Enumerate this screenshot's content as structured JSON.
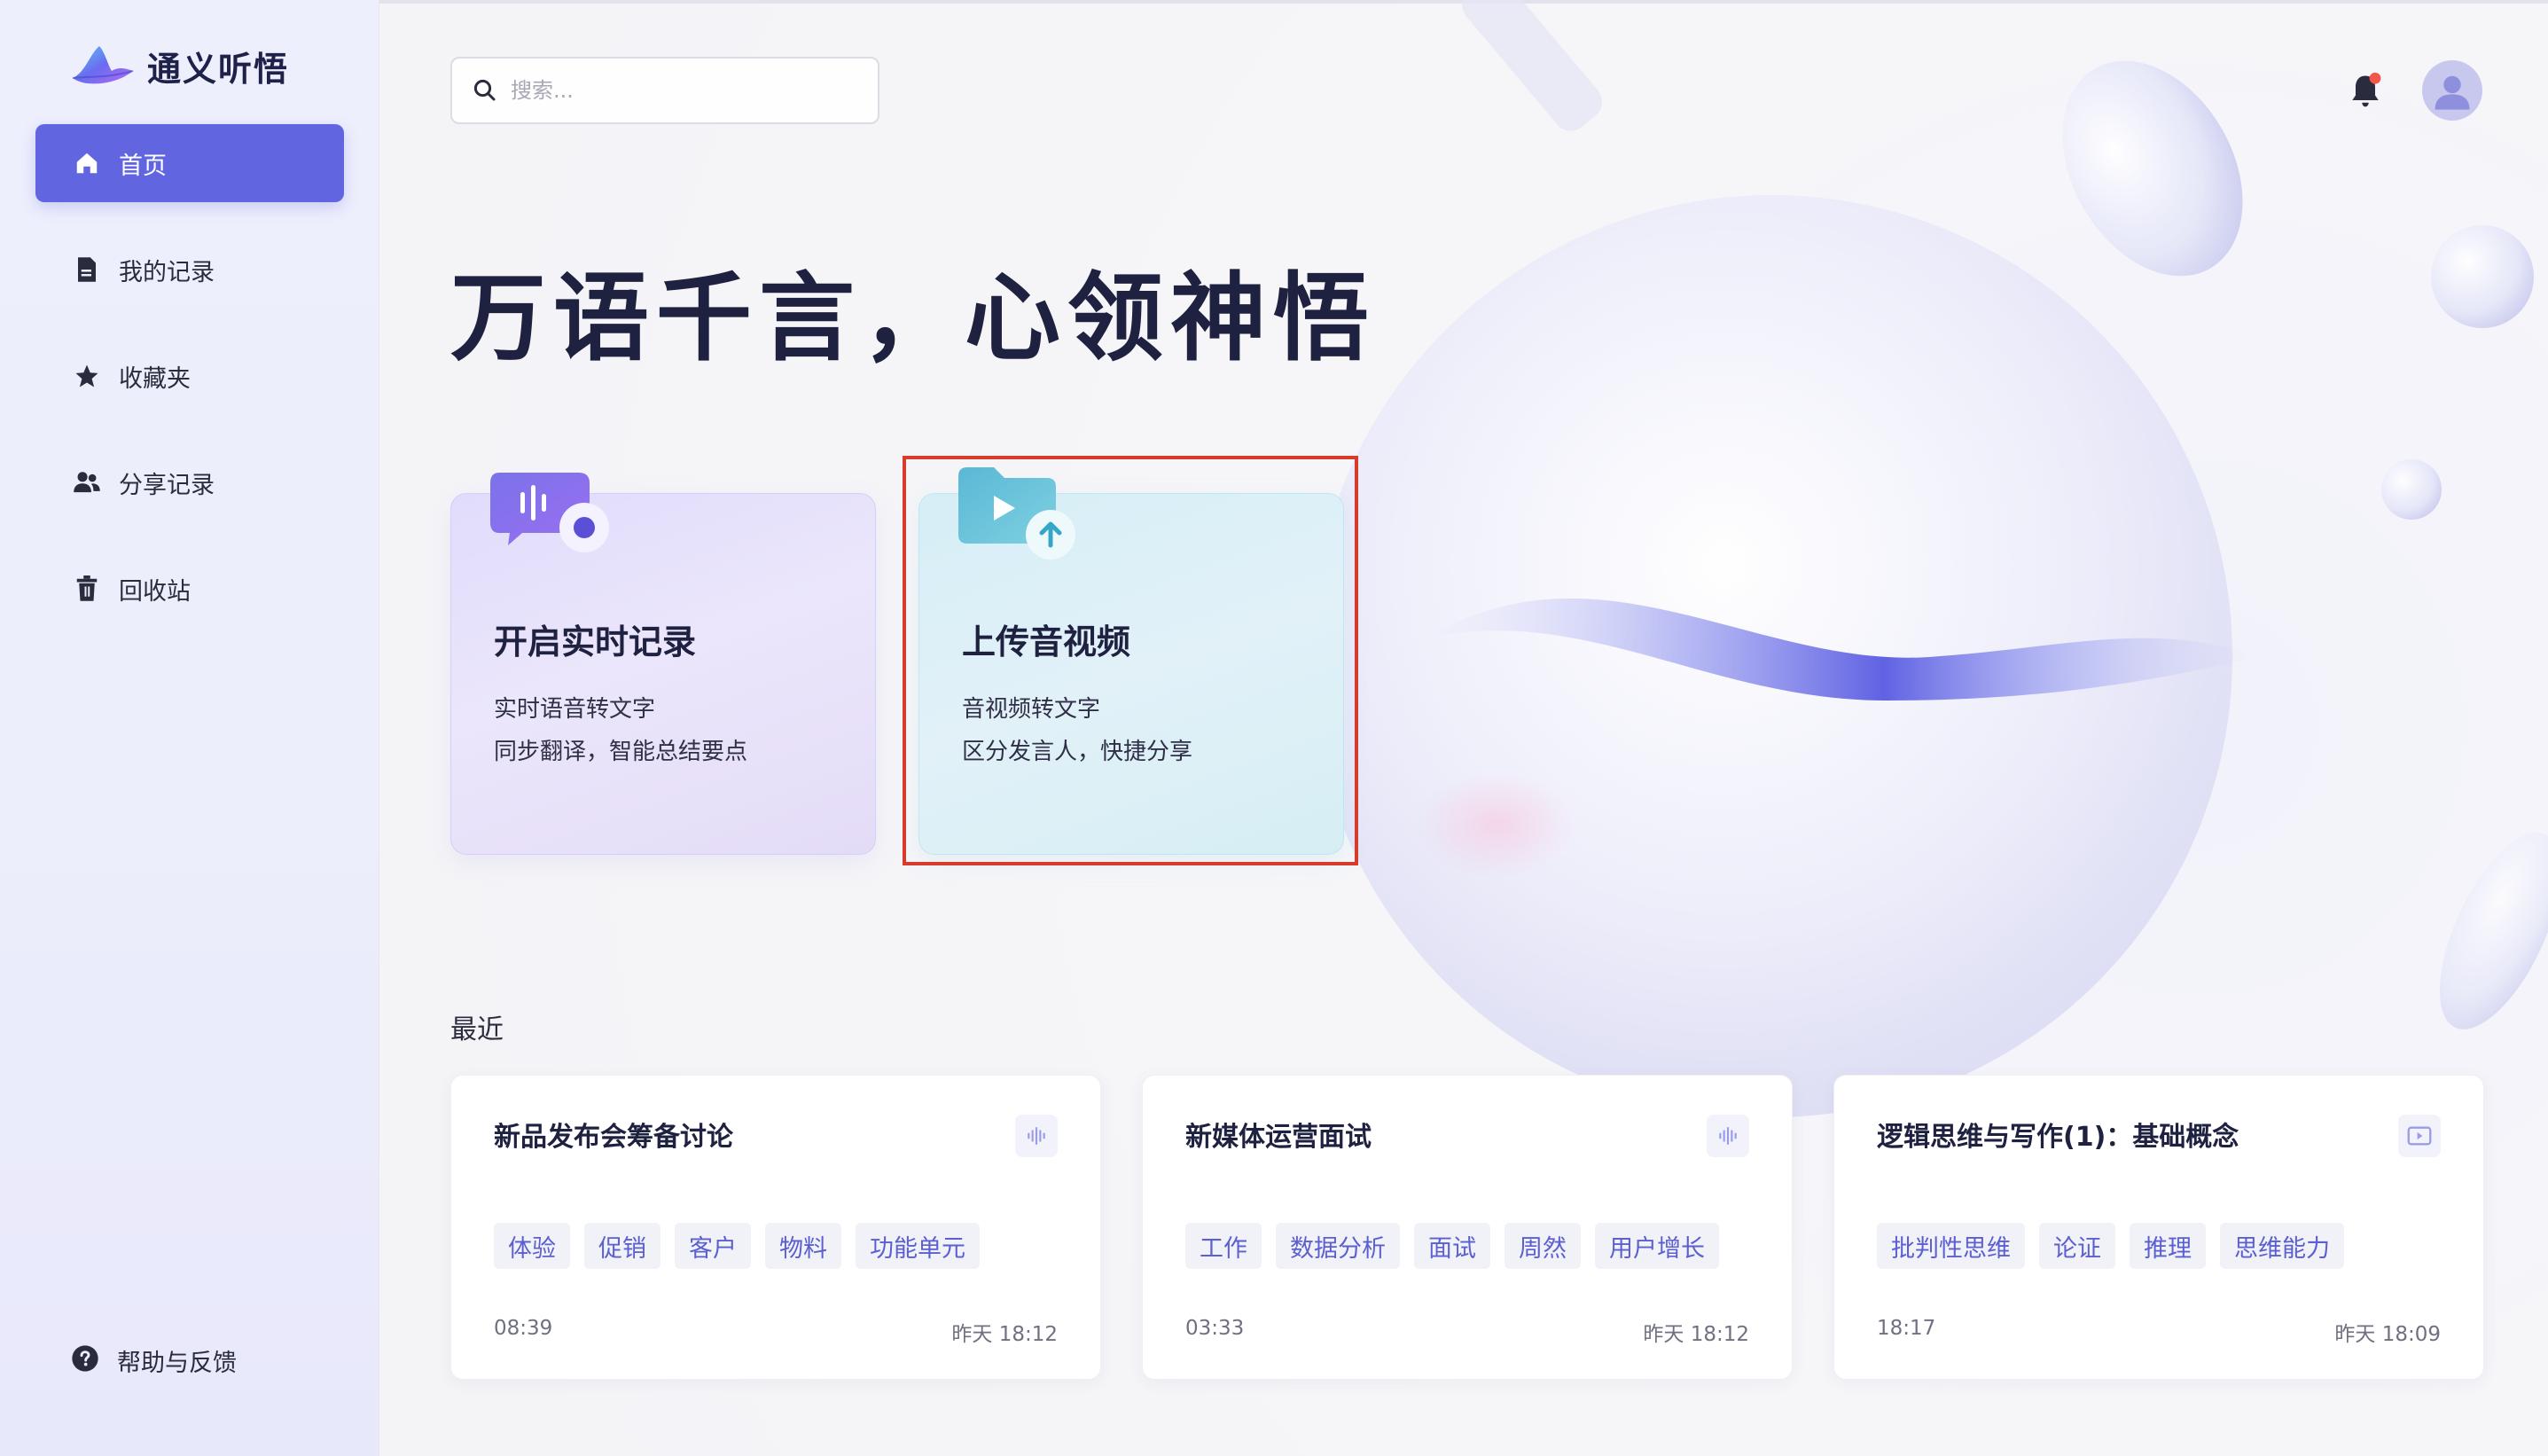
{
  "app": {
    "name": "通义听悟"
  },
  "sidebar": {
    "items": [
      {
        "label": "首页",
        "icon": "home-icon",
        "active": true
      },
      {
        "label": "我的记录",
        "icon": "document-icon",
        "active": false
      },
      {
        "label": "收藏夹",
        "icon": "star-icon",
        "active": false
      },
      {
        "label": "分享记录",
        "icon": "users-icon",
        "active": false
      },
      {
        "label": "回收站",
        "icon": "trash-icon",
        "active": false
      }
    ],
    "help": {
      "label": "帮助与反馈",
      "icon": "help-icon"
    }
  },
  "search": {
    "placeholder": "搜索...",
    "value": ""
  },
  "header": {
    "has_notification": true
  },
  "hero": {
    "title": "万语千言，心领神悟"
  },
  "features": [
    {
      "title": "开启实时记录",
      "lines": [
        "实时语音转文字",
        "同步翻译，智能总结要点"
      ],
      "icon": "realtime-record-icon"
    },
    {
      "title": "上传音视频",
      "lines": [
        "音视频转文字",
        "区分发言人，快捷分享"
      ],
      "icon": "upload-video-icon",
      "highlighted": true
    }
  ],
  "recent": {
    "label": "最近",
    "items": [
      {
        "title": "新品发布会筹备讨论",
        "type_icon": "audio-wave-icon",
        "tags": [
          "体验",
          "促销",
          "客户",
          "物料",
          "功能单元"
        ],
        "duration": "08:39",
        "time": "昨天 18:12"
      },
      {
        "title": "新媒体运营面试",
        "type_icon": "audio-wave-icon",
        "tags": [
          "工作",
          "数据分析",
          "面试",
          "周然",
          "用户增长"
        ],
        "duration": "03:33",
        "time": "昨天 18:12"
      },
      {
        "title": "逻辑思维与写作(1)：基础概念",
        "type_icon": "video-icon",
        "tags": [
          "批判性思维",
          "论证",
          "推理",
          "思维能力"
        ],
        "duration": "18:17",
        "time": "昨天 18:09"
      }
    ]
  },
  "colors": {
    "accent": "#6165e0",
    "tag_text": "#5b5fcf",
    "highlight": "#d83a2c"
  }
}
